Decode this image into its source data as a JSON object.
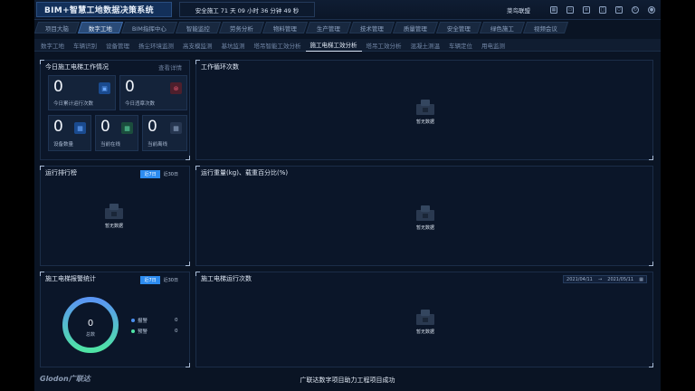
{
  "header": {
    "title": "BIM+智慧工地数据决策系统",
    "safety_text": "安全施工 71 天 09 小时 36 分钟 49 秒",
    "user": "菜鸟联盟",
    "toolbar_icons": [
      "grid-icon",
      "monitor-icon",
      "document-icon",
      "chat-icon",
      "shield-icon",
      "refresh-icon",
      "user-icon"
    ]
  },
  "tabs": [
    {
      "label": "项目大脑",
      "active": false
    },
    {
      "label": "数字工地",
      "active": true
    },
    {
      "label": "BIM指挥中心",
      "active": false
    },
    {
      "label": "智能监控",
      "active": false
    },
    {
      "label": "劳务分析",
      "active": false
    },
    {
      "label": "物料管理",
      "active": false
    },
    {
      "label": "生产管理",
      "active": false
    },
    {
      "label": "技术管理",
      "active": false
    },
    {
      "label": "质量管理",
      "active": false
    },
    {
      "label": "安全管理",
      "active": false
    },
    {
      "label": "绿色施工",
      "active": false
    },
    {
      "label": "视频会议",
      "active": false
    }
  ],
  "subnav": [
    {
      "label": "数字工地",
      "active": false
    },
    {
      "label": "车辆识别",
      "active": false
    },
    {
      "label": "设备管理",
      "active": false
    },
    {
      "label": "扬尘环境监测",
      "active": false
    },
    {
      "label": "高支模监测",
      "active": false
    },
    {
      "label": "基坑监测",
      "active": false
    },
    {
      "label": "塔吊智能工效分析",
      "active": false
    },
    {
      "label": "施工电梯工效分析",
      "active": true
    },
    {
      "label": "塔吊工效分析",
      "active": false
    },
    {
      "label": "混凝土测温",
      "active": false
    },
    {
      "label": "车辆定位",
      "active": false
    },
    {
      "label": "用电监测",
      "active": false
    }
  ],
  "today_panel": {
    "title": "今日施工电梯工作情况",
    "link": "查看详情",
    "stats": {
      "runs": {
        "value": "0",
        "label": "今日累计运行次数",
        "icon": "elevator-icon"
      },
      "violations": {
        "value": "0",
        "label": "今日违章次数",
        "icon": "alarm-icon"
      },
      "devices": {
        "value": "0",
        "label": "设备数量",
        "icon": "device-icon"
      },
      "online": {
        "value": "0",
        "label": "当前在线",
        "icon": "online-icon"
      },
      "offline": {
        "value": "0",
        "label": "当前离线",
        "icon": "offline-icon"
      }
    }
  },
  "work_cycles_panel": {
    "title": "工作循环次数",
    "empty_text": "暂无数据"
  },
  "ranking_panel": {
    "title": "运行排行榜",
    "toggle": [
      "近7日",
      "近30日"
    ],
    "toggle_active": 0,
    "empty_text": "暂无数据"
  },
  "load_panel": {
    "title": "运行重量(kg)、载重百分比(%)",
    "empty_text": "暂无数据"
  },
  "alarm_panel": {
    "title": "施工电梯报警统计",
    "toggle": [
      "近7日",
      "近30日"
    ],
    "toggle_active": 0,
    "total_value": "0",
    "total_label": "总数",
    "legend": [
      {
        "label": "报警",
        "value": "0",
        "color": "#4a8ff0"
      },
      {
        "label": "预警",
        "value": "0",
        "color": "#4fe3a5"
      }
    ]
  },
  "runs_panel": {
    "title": "施工电梯运行次数",
    "date_start": "2021/04/11",
    "date_sep": "→",
    "date_end": "2021/05/11",
    "empty_text": "暂无数据"
  },
  "footer": {
    "logo": "Glodon广联达",
    "slogan": "广联达数字项目助力工程项目成功"
  }
}
